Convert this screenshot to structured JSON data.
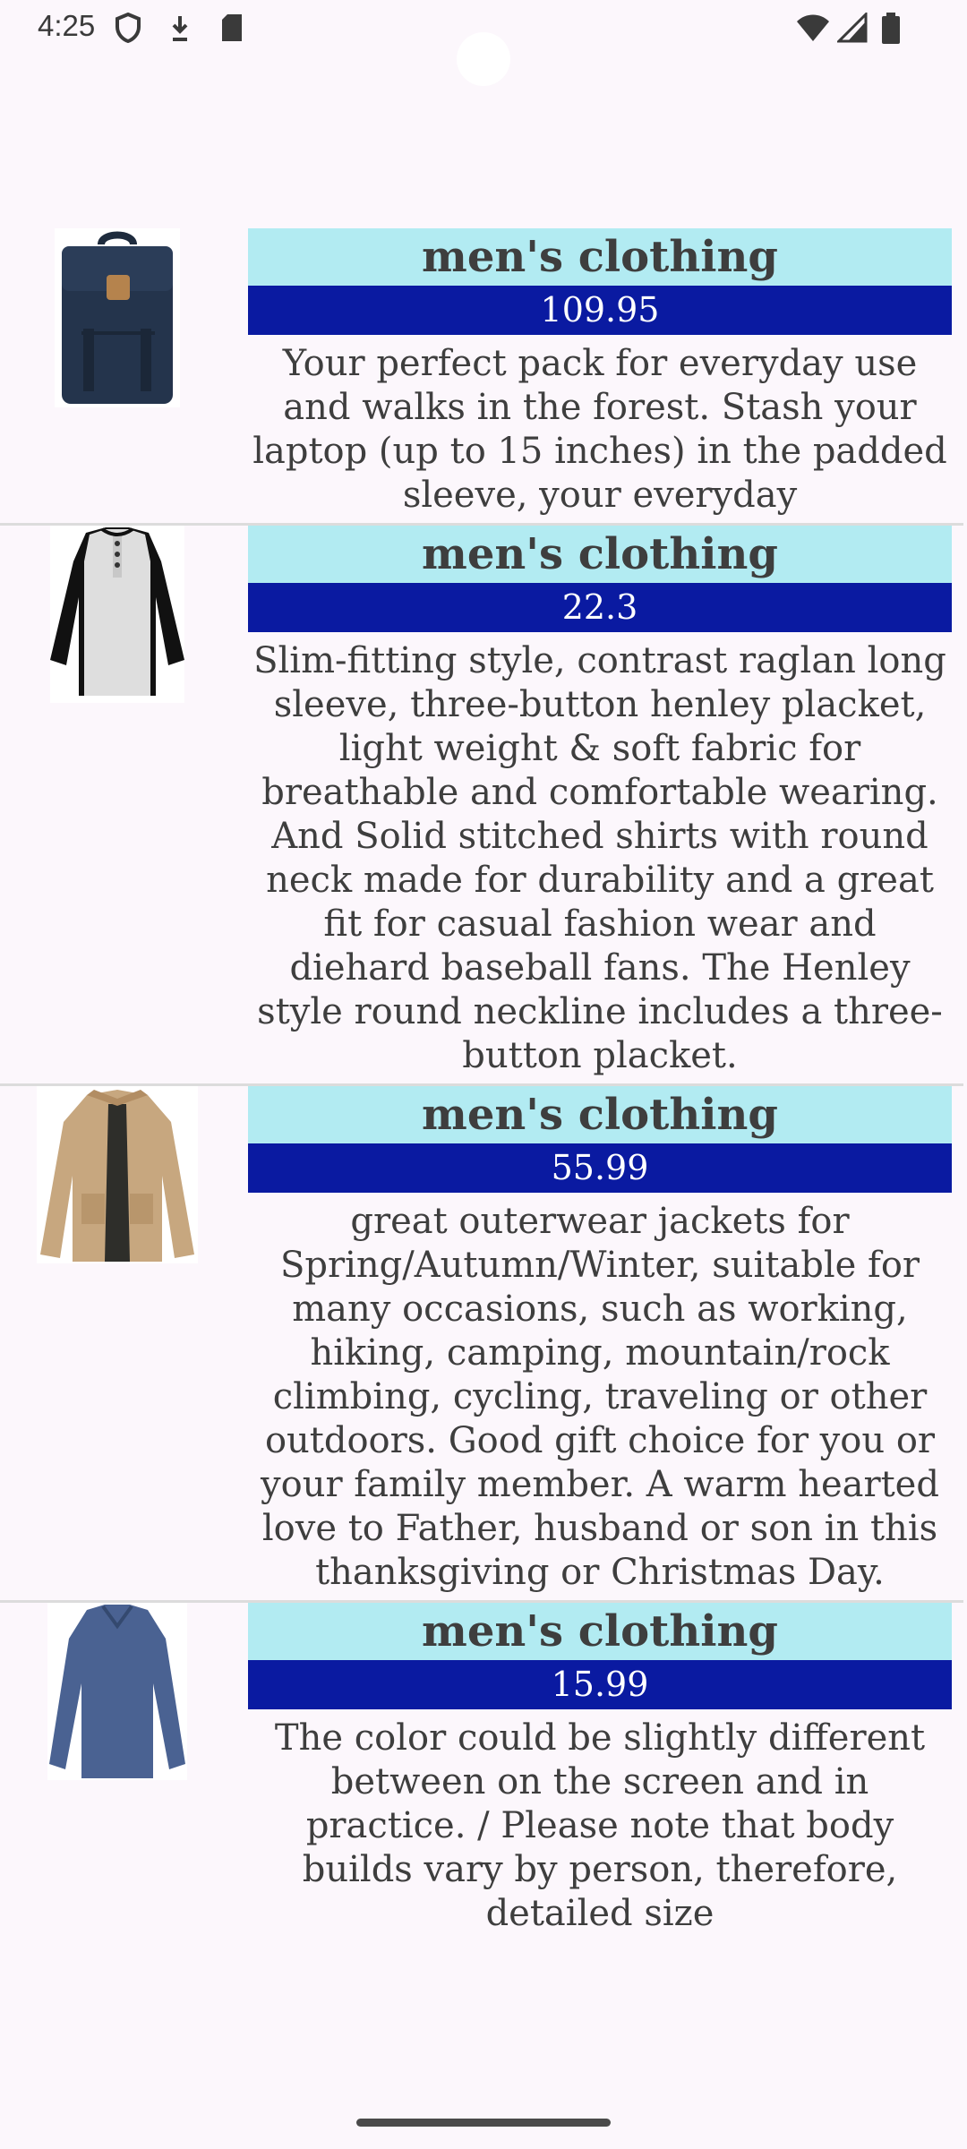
{
  "status_bar": {
    "time": "4:25",
    "left_icons": [
      "shield-icon",
      "download-icon",
      "sd-card-icon"
    ],
    "right_icons": [
      "wifi-icon",
      "signal-icon",
      "battery-icon"
    ]
  },
  "products": [
    {
      "category": "men's clothing",
      "price": "109.95",
      "description": "Your perfect pack for everyday use and walks in the forest. Stash your laptop (up to 15 inches) in the padded sleeve, your everyday",
      "image": "backpack-image"
    },
    {
      "category": "men's clothing",
      "price": "22.3",
      "description": "Slim-fitting style, contrast raglan long sleeve, three-button henley placket, light weight & soft fabric for breathable and comfortable wearing. And Solid stitched shirts with round neck made for durability and a great fit for casual fashion wear and diehard baseball fans. The Henley style round neckline includes a three-button placket.",
      "image": "henley-shirt-image"
    },
    {
      "category": "men's clothing",
      "price": "55.99",
      "description": "great outerwear jackets for Spring/Autumn/Winter, suitable for many occasions, such as working, hiking, camping, mountain/rock climbing, cycling, traveling or other outdoors. Good gift choice for you or your family member. A warm hearted love to Father, husband or son in this thanksgiving or Christmas Day.",
      "image": "jacket-image"
    },
    {
      "category": "men's clothing",
      "price": "15.99",
      "description": "The color could be slightly different between on the screen and in practice. / Please note that body builds vary by person, therefore, detailed size",
      "image": "long-sleeve-shirt-image"
    }
  ]
}
